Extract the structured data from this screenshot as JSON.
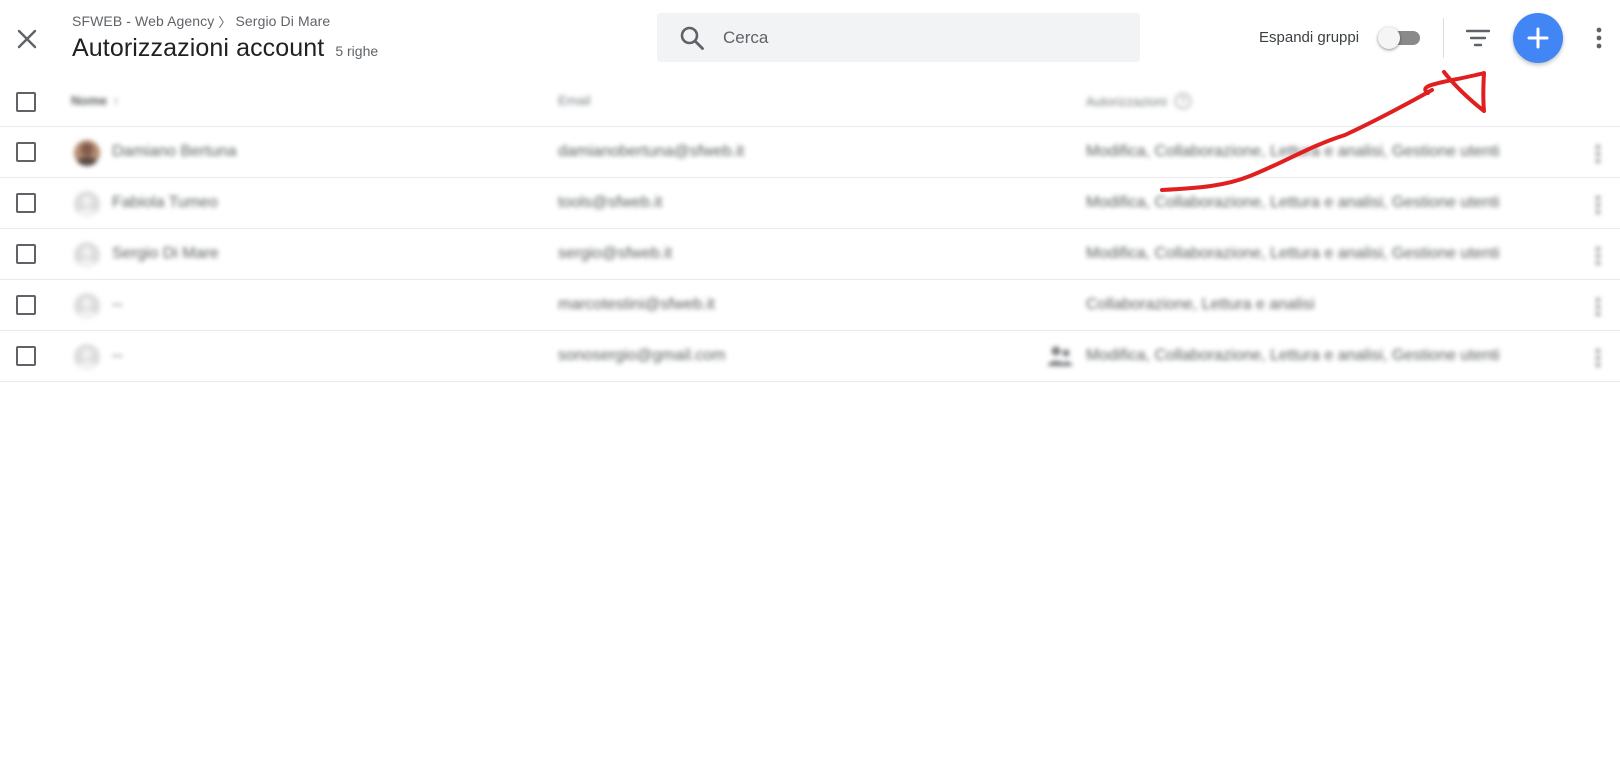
{
  "header": {
    "close_icon": "close-icon",
    "breadcrumb": {
      "account": "SFWEB - Web Agency",
      "separator": "〉",
      "property": "Sergio Di Mare"
    },
    "title": "Autorizzazioni account",
    "row_count": "5 righe"
  },
  "search": {
    "placeholder": "Cerca",
    "value": ""
  },
  "toolbar": {
    "expand_groups_label": "Espandi gruppi",
    "expand_groups_on": false,
    "filter_icon": "filter-icon",
    "add_icon": "plus-icon",
    "more_icon": "more-vert-icon"
  },
  "table": {
    "columns": {
      "name": "Nome",
      "email": "Email",
      "permissions": "Autorizzazioni"
    },
    "sort_arrow": "↑",
    "help_glyph": "?",
    "rows": [
      {
        "name": "Damiano Bertuna",
        "email": "damianobertuna@sfweb.it",
        "permissions": "Modifica, Collaborazione, Lettura e analisi, Gestione utenti",
        "avatar": "photo",
        "group": false
      },
      {
        "name": "Fabiola Tumeo",
        "email": "tools@sfweb.it",
        "permissions": "Modifica, Collaborazione, Lettura e analisi, Gestione utenti",
        "avatar": "generic",
        "group": false
      },
      {
        "name": "Sergio Di Mare",
        "email": "sergio@sfweb.it",
        "permissions": "Modifica, Collaborazione, Lettura e analisi, Gestione utenti",
        "avatar": "generic",
        "group": false
      },
      {
        "name": "--",
        "email": "marcotestini@sfweb.it",
        "permissions": "Collaborazione, Lettura e analisi",
        "avatar": "generic",
        "group": false
      },
      {
        "name": "--",
        "email": "sonosergio@gmail.com",
        "permissions": "Modifica, Collaborazione, Lettura e analisi, Gestione utenti",
        "avatar": "generic",
        "group": true
      }
    ]
  },
  "colors": {
    "accent": "#4285f4",
    "annotation": "#e02020",
    "search_bg": "#f1f3f4",
    "text": "#202124",
    "muted": "#5f6368"
  }
}
